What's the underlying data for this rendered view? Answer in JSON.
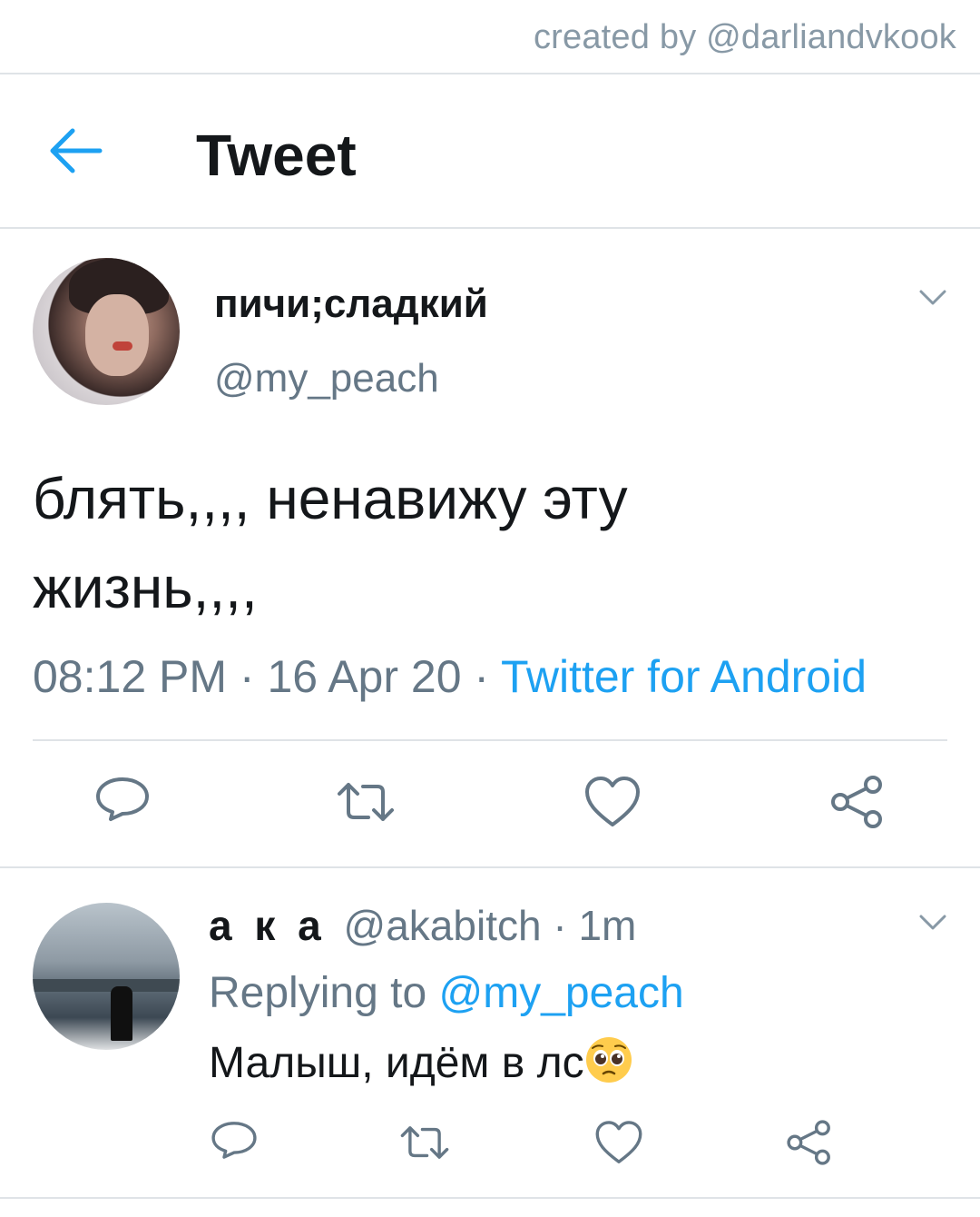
{
  "credit": "created by @darliandvkook",
  "header": {
    "title": "Tweet"
  },
  "tweet": {
    "author_name": "пичи;сладкий",
    "author_handle": "@my_peach",
    "text_line1": "блять,,,, ненавижу эту",
    "text_line2": "жизнь,,,,",
    "time": "08:12 PM",
    "date": "16 Apr 20",
    "source": "Twitter for Android",
    "separator": " · "
  },
  "reply": {
    "author_name": "а к а",
    "author_handle": "@akabitch",
    "separator": " · ",
    "time": "1m",
    "replying_prefix": "Replying to ",
    "replying_to": "@my_peach",
    "text": "Малыш, идём в лс",
    "emoji": "pleading-face-emoji"
  },
  "icons": {
    "back": "arrow-left-icon",
    "menu": "chevron-down-icon",
    "reply": "reply-icon",
    "retweet": "retweet-icon",
    "like": "heart-icon",
    "share": "share-icon"
  },
  "colors": {
    "accent": "#1da1f2",
    "text": "#14171a",
    "muted": "#657786",
    "icon": "#657786",
    "divider": "#dfe3e7"
  }
}
